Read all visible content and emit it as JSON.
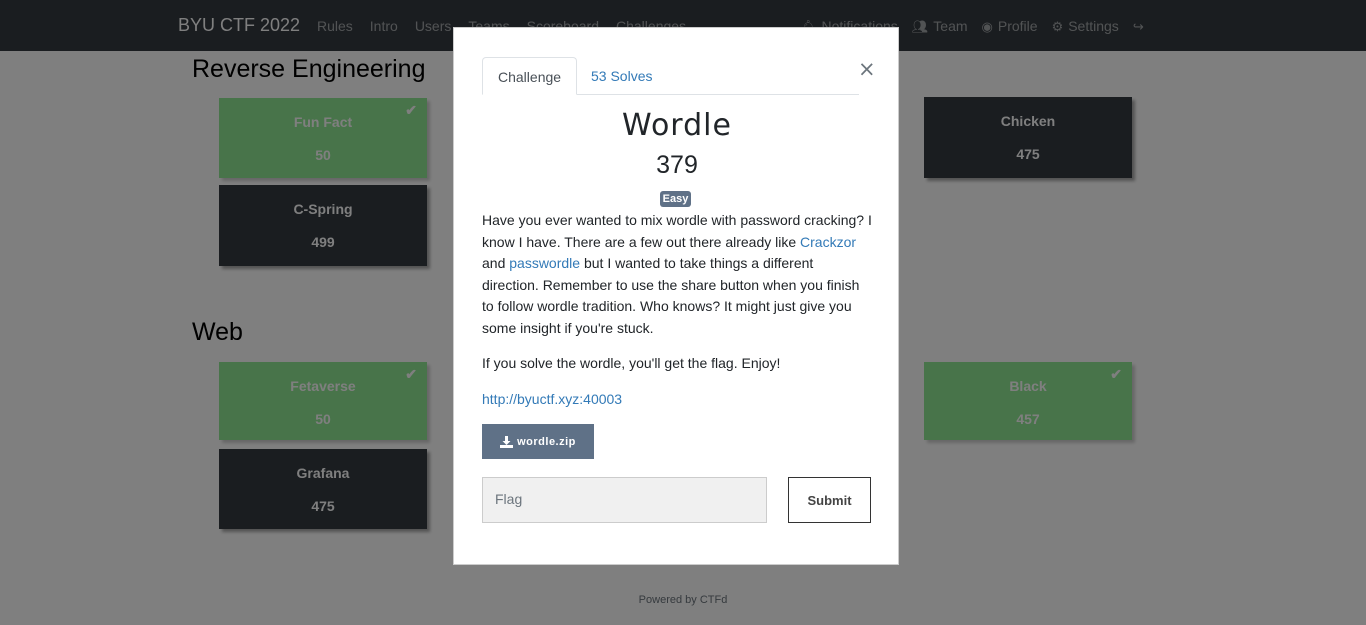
{
  "navbar": {
    "brand": "BYU CTF 2022",
    "left_links": [
      "Rules",
      "Intro",
      "Users",
      "Teams",
      "Scoreboard",
      "Challenges"
    ],
    "right_links": [
      {
        "icon": "bell-icon",
        "label": "Notifications"
      },
      {
        "icon": "users-icon",
        "label": "Team"
      },
      {
        "icon": "user-circle-icon",
        "label": "Profile"
      },
      {
        "icon": "cogs-icon",
        "label": "Settings"
      },
      {
        "icon": "sign-out-icon",
        "label": ""
      }
    ]
  },
  "board": {
    "categories": [
      {
        "title": "Reverse Engineering",
        "cards": [
          {
            "name": "Fun Fact",
            "value": "50",
            "solved": true
          },
          {
            "name": "Chicken",
            "value": "475",
            "solved": false
          },
          {
            "name": "C-Spring",
            "value": "499",
            "solved": false
          }
        ]
      },
      {
        "title": "Web",
        "cards": [
          {
            "name": "Fetaverse",
            "value": "50",
            "solved": true
          },
          {
            "name": "Black",
            "value": "457",
            "solved": true
          },
          {
            "name": "Grafana",
            "value": "475",
            "solved": false
          }
        ]
      }
    ]
  },
  "footer": "Powered by CTFd",
  "modal": {
    "tabs": [
      "Challenge",
      "53 Solves"
    ],
    "close": "×",
    "title": "Wordle",
    "value": "379",
    "badge": "Easy",
    "description": {
      "p1_a": "Have you ever wanted to mix wordle with password cracking? I know I have. There are a few out there already like ",
      "link1": "Crackzor",
      "p1_b": " and ",
      "link2": "passwordle",
      "p1_c": " but I wanted to take things a different direction. Remember to use the share button when you finish to follow wordle tradition. Who knows? It might just give you some insight if you're stuck.",
      "p2": "If you solve the wordle, you'll get the flag. Enjoy!",
      "url": "http://byuctf.xyz:40003"
    },
    "file_button": "wordle.zip",
    "flag_placeholder": "Flag",
    "submit": "Submit"
  },
  "colors": {
    "navbar": "#343a40",
    "card_dark": "#343a40",
    "card_solved": "#37d63e",
    "link": "#337ab7",
    "badge": "#5f7187"
  }
}
